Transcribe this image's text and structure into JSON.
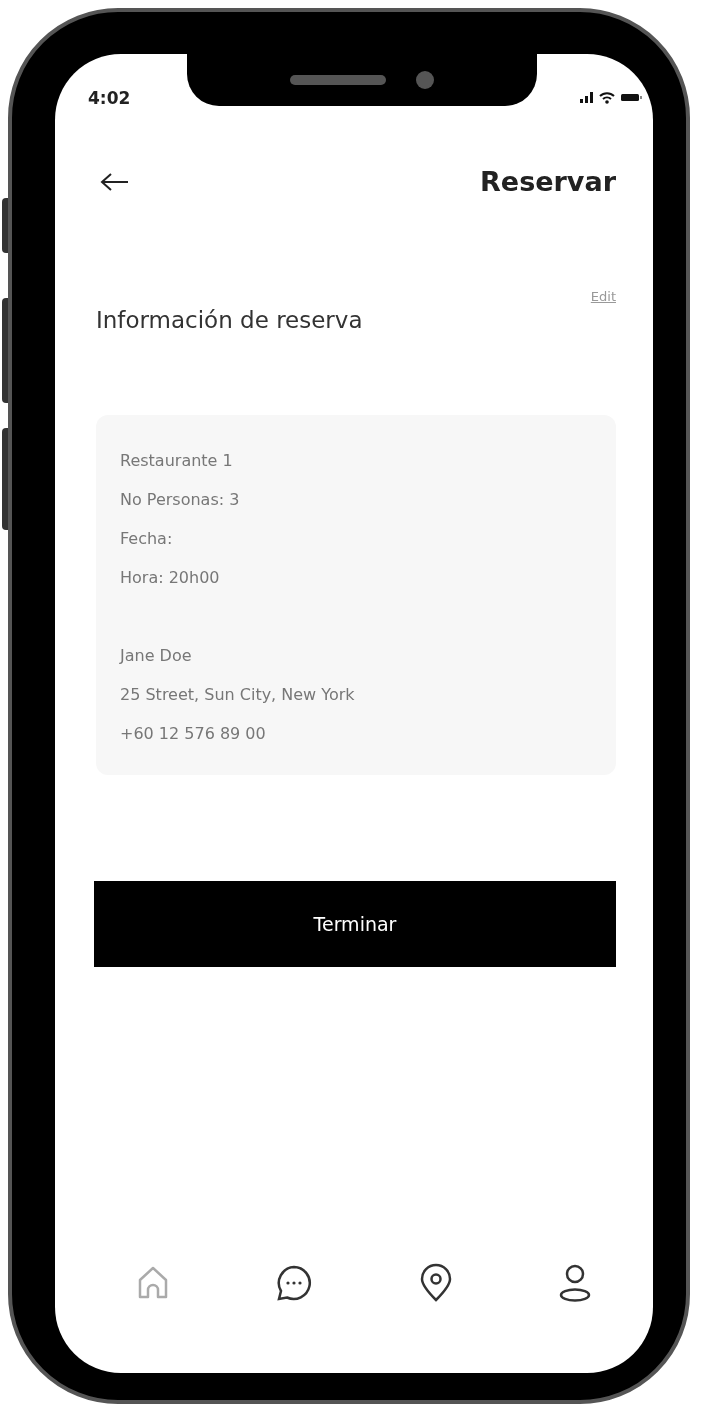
{
  "status_bar": {
    "time": "4:02"
  },
  "header": {
    "title": "Reservar"
  },
  "section": {
    "title": "Información de reserva",
    "edit_link": "Edit"
  },
  "card": {
    "groups": [
      {
        "lines": [
          "Restaurante 1",
          "No Personas: 3",
          "Fecha:",
          "Hora: 20h00"
        ]
      },
      {
        "lines": [
          "Jane Doe",
          "25 Street, Sun City, New York",
          "+60 12 576 89 00"
        ]
      }
    ]
  },
  "button": "Terminar",
  "nav": [
    {
      "kind": "home"
    },
    {
      "kind": "chat"
    },
    {
      "kind": "location"
    },
    {
      "kind": "profile"
    }
  ]
}
